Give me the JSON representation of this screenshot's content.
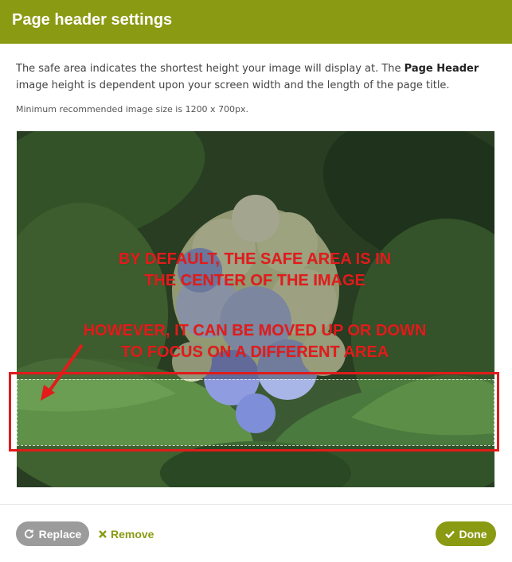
{
  "dialog": {
    "title": "Page header settings",
    "description_part1": "The safe area indicates the shortest height your image will display at. The ",
    "description_bold": "Page Header",
    "description_part2": " image height is dependent upon your screen width and the length of the page title.",
    "min_size_note": "Minimum recommended image size is 1200 x 700px."
  },
  "image": {
    "subject": "hydrangea flower photo",
    "safe_area": "safe area overlay"
  },
  "annotations": {
    "line1": "BY DEFAULT, THE SAFE AREA IS IN",
    "line2": "THE CENTER OF THE IMAGE",
    "line3": "HOWEVER, IT CAN BE MOVED UP OR DOWN",
    "line4": "TO FOCUS ON A DIFFERENT AREA",
    "color": "#e31b1b"
  },
  "footer": {
    "replace_label": "Replace",
    "replace_icon": "refresh-icon",
    "remove_label": "Remove",
    "remove_icon": "x-icon",
    "done_label": "Done",
    "done_icon": "check-icon"
  },
  "colors": {
    "brand": "#8a9a12",
    "replace_button": "#9b9b9b"
  }
}
